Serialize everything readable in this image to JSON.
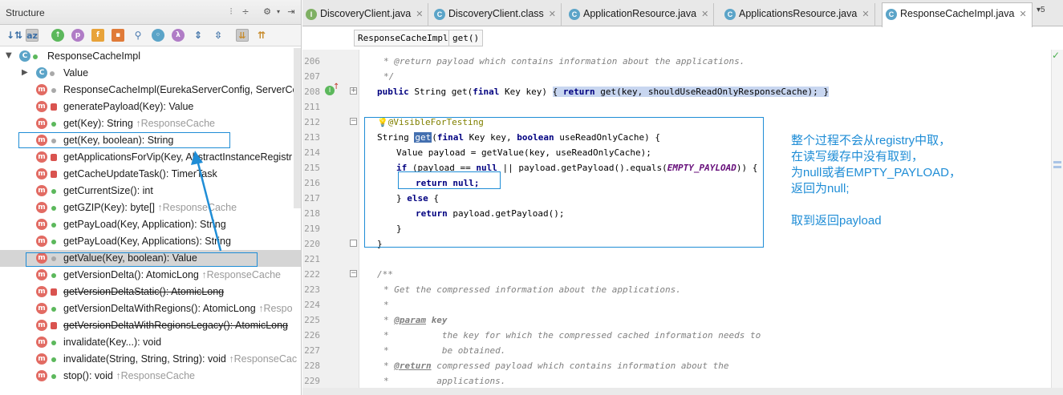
{
  "structure": {
    "title": "Structure",
    "header_icons": [
      "split-icon",
      "collapse-icon",
      "gear-icon",
      "hide-icon"
    ],
    "toolbar_icons": [
      "sort-visibility-icon",
      "sort-alpha-icon",
      "show-inherited-icon",
      "show-properties-icon",
      "show-fields-icon",
      "show-non-public-icon",
      "show-anonymous-icon",
      "show-lambdas-icon",
      "expand-all-icon",
      "collapse-all-icon",
      "autoscroll-to-source-icon",
      "autoscroll-from-source-icon"
    ],
    "items": [
      {
        "label": "ResponseCacheImpl",
        "inherited": "",
        "kind": "class",
        "deprecated": false
      },
      {
        "label": "Value",
        "inherited": "",
        "kind": "class",
        "deprecated": false
      },
      {
        "label": "ResponseCacheImpl(EurekaServerConfig, ServerCo",
        "inherited": "",
        "kind": "method",
        "deprecated": false
      },
      {
        "label": "generatePayload(Key): Value",
        "inherited": "",
        "kind": "method",
        "deprecated": false
      },
      {
        "label": "get(Key): String ",
        "inherited": "↑ResponseCache",
        "kind": "method",
        "deprecated": false
      },
      {
        "label": "get(Key, boolean): String",
        "inherited": "",
        "kind": "method",
        "deprecated": false
      },
      {
        "label": "getApplicationsForVip(Key, AbstractInstanceRegistr",
        "inherited": "",
        "kind": "method",
        "deprecated": false
      },
      {
        "label": "getCacheUpdateTask(): TimerTask",
        "inherited": "",
        "kind": "method",
        "deprecated": false
      },
      {
        "label": "getCurrentSize(): int",
        "inherited": "",
        "kind": "method",
        "deprecated": false
      },
      {
        "label": "getGZIP(Key): byte[] ",
        "inherited": "↑ResponseCache",
        "kind": "method",
        "deprecated": false
      },
      {
        "label": "getPayLoad(Key, Application): String",
        "inherited": "",
        "kind": "method",
        "deprecated": false
      },
      {
        "label": "getPayLoad(Key, Applications): String",
        "inherited": "",
        "kind": "method",
        "deprecated": false
      },
      {
        "label": "getValue(Key, boolean): Value",
        "inherited": "",
        "kind": "method",
        "deprecated": false
      },
      {
        "label": "getVersionDelta(): AtomicLong ",
        "inherited": "↑ResponseCache",
        "kind": "method",
        "deprecated": false
      },
      {
        "label": "getVersionDeltaStatic(): AtomicLong",
        "inherited": "",
        "kind": "method",
        "deprecated": true
      },
      {
        "label": "getVersionDeltaWithRegions(): AtomicLong ",
        "inherited": "↑Respo",
        "kind": "method",
        "deprecated": false
      },
      {
        "label": "getVersionDeltaWithRegionsLegacy(): AtomicLong",
        "inherited": "",
        "kind": "method",
        "deprecated": true
      },
      {
        "label": "invalidate(Key...): void",
        "inherited": "",
        "kind": "method",
        "deprecated": false
      },
      {
        "label": "invalidate(String, String, String): void ",
        "inherited": "↑ResponseCac",
        "kind": "method",
        "deprecated": false
      },
      {
        "label": "stop(): void ",
        "inherited": "↑ResponseCache",
        "kind": "method",
        "deprecated": false
      }
    ]
  },
  "tabs": [
    {
      "label": "DiscoveryClient.java",
      "icon": "I"
    },
    {
      "label": "DiscoveryClient.class",
      "icon": "C"
    },
    {
      "label": "ApplicationResource.java",
      "icon": "C"
    },
    {
      "label": "ApplicationsResource.java",
      "icon": "C"
    },
    {
      "label": "ResponseCacheImpl.java",
      "icon": "C"
    }
  ],
  "tab_overflow": "▾5",
  "breadcrumbs": [
    "ResponseCacheImpl",
    "get()"
  ],
  "line_numbers": [
    "206",
    "207",
    "208",
    "211",
    "212",
    "213",
    "214",
    "215",
    "216",
    "217",
    "218",
    "219",
    "220",
    "221",
    "222",
    "223",
    "224",
    "225",
    "226",
    "227",
    "228",
    "229"
  ],
  "code": {
    "l206": "* @return payload which contains information about the applications.",
    "l207": "*/",
    "l208a": "public String get(final Key key)",
    "l208b": "{ return get(key, shouldUseReadOnlyResponseCache); }",
    "l212": "@VisibleForTesting",
    "l213a": "String ",
    "l213b": "get",
    "l213c": "(final Key key, boolean useReadOnlyCache) {",
    "l214": "Value payload = getValue(key, useReadOnlyCache);",
    "l215a": "if (payload == null || payload.getPayload().equals(",
    "l215b": "EMPTY_PAYLOAD",
    "l215c": ")) {",
    "l216": "return null;",
    "l217": "} else {",
    "l218": "return payload.getPayload();",
    "l219": "}",
    "l220": "}",
    "l222": "/**",
    "l223": "* Get the compressed information about the applications.",
    "l224": "*",
    "l225a": "* ",
    "l225b": "@param",
    "l225c": " key",
    "l226": "*          the key for which the compressed cached information needs to",
    "l227": "*          be obtained.",
    "l228a": "* ",
    "l228b": "@return",
    "l228c": " compressed payload which contains information about the",
    "l229": "*         applications."
  },
  "note": {
    "lines": [
      "整个过程不会从registry中取，",
      "在读写缓存中没有取到，",
      "为null或者EMPTY_PAYLOAD，",
      "返回为null;",
      "",
      "取到返回payload"
    ]
  },
  "colors": {
    "annotation_blue": "#1f8dd6",
    "keyword": "#000080",
    "doc": "#808080",
    "field": "#660e7a"
  }
}
